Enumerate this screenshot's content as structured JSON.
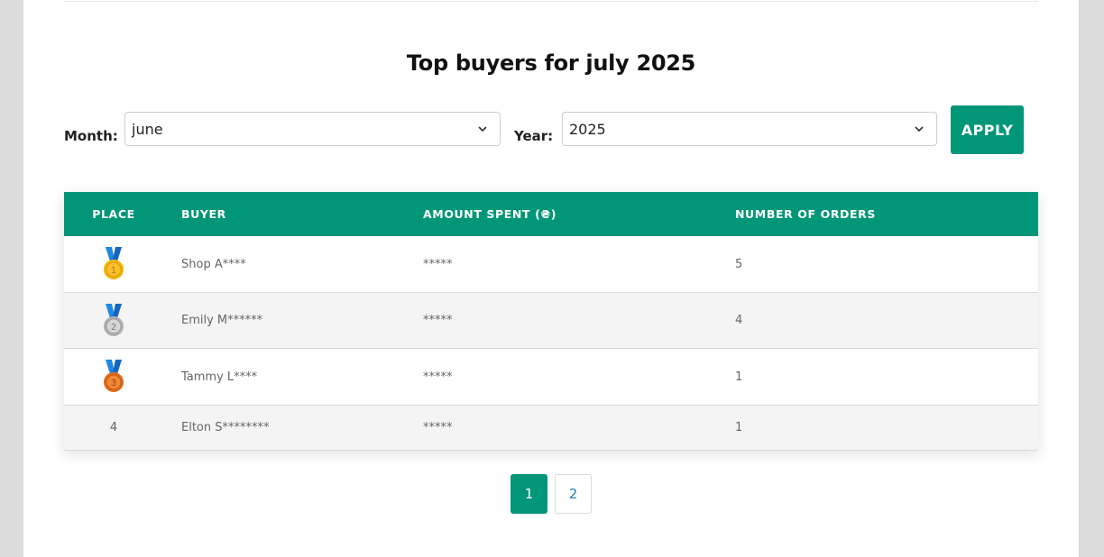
{
  "title": "Top buyers for july 2025",
  "filters": {
    "month_label": "Month:",
    "month_value": "june",
    "year_label": "Year:",
    "year_value": "2025",
    "apply_label": "APPLY"
  },
  "table": {
    "headers": [
      "PLACE",
      "BUYER",
      "AMOUNT SPENT (₴)",
      "NUMBER OF ORDERS"
    ],
    "rows": [
      {
        "place": "1",
        "medal": "gold-medal-icon",
        "buyer": "Shop A****",
        "amount": "*****",
        "orders": "5"
      },
      {
        "place": "2",
        "medal": "silver-medal-icon",
        "buyer": "Emily M******",
        "amount": "*****",
        "orders": "4"
      },
      {
        "place": "3",
        "medal": "bronze-medal-icon",
        "buyer": "Tammy L****",
        "amount": "*****",
        "orders": "1"
      },
      {
        "place": "4",
        "medal": null,
        "buyer": "Elton S********",
        "amount": "*****",
        "orders": "1"
      }
    ]
  },
  "pagination": {
    "pages": [
      "1",
      "2"
    ],
    "current": "1"
  },
  "colors": {
    "accent": "#009677",
    "page_bg": "#dcdcdc",
    "row_alt": "#f4f4f4",
    "link": "#1a7fb5"
  }
}
